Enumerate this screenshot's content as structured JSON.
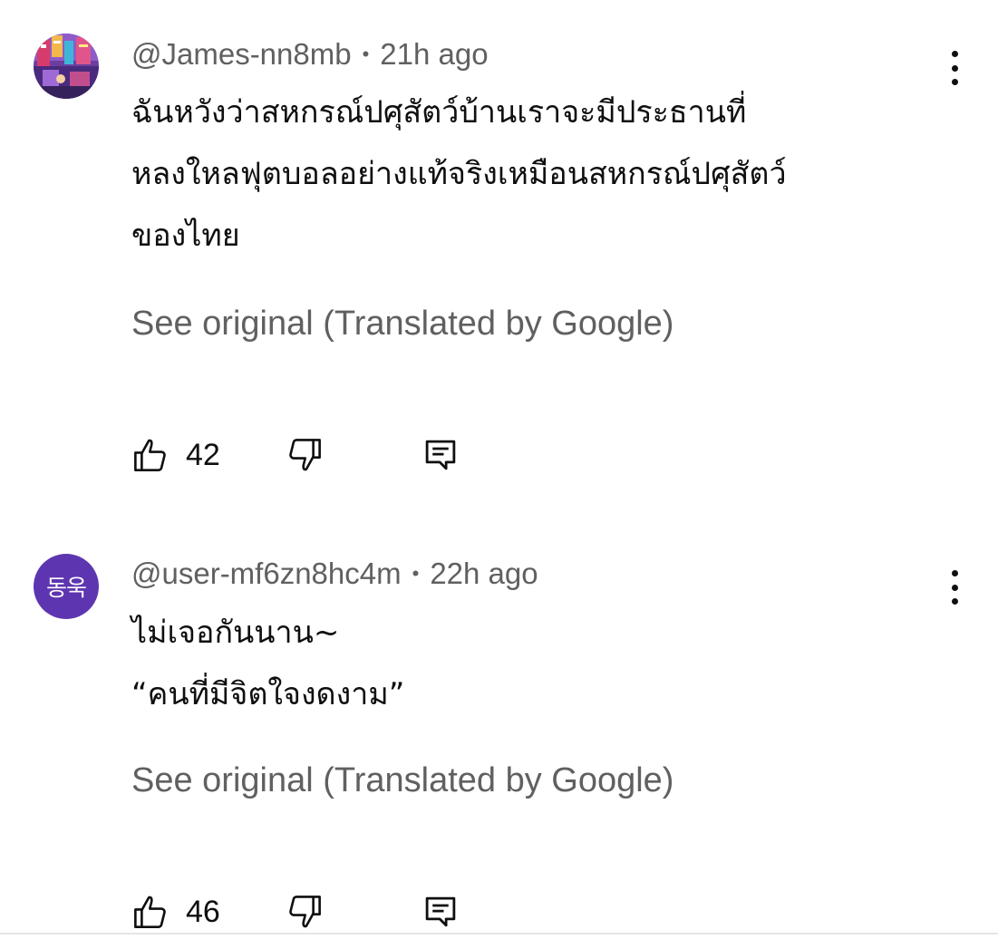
{
  "comments": [
    {
      "author": "@James-nn8mb",
      "time": "21h ago",
      "text": "ฉันหวังว่าสหกรณ์ปศุสัตว์บ้านเราจะมีประธานที่\nหลงใหลฟุตบอลอย่างแท้จริงเหมือนสหกรณ์ปศุสัตว์\nของไทย",
      "see_original": "See original (Translated by Google)",
      "likes": "42",
      "avatar_type": "image",
      "avatar_initials": ""
    },
    {
      "author": "@user-mf6zn8hc4m",
      "time": "22h ago",
      "text": "ไม่เจอกันนาน~\n“คนที่มีจิตใจงดงาม”",
      "see_original": "See original (Translated by Google)",
      "likes": "46",
      "avatar_type": "initials",
      "avatar_initials": "동욱"
    }
  ],
  "meta_separator": "•",
  "icons": {
    "like": "thumb-up-icon",
    "dislike": "thumb-down-icon",
    "reply": "reply-comment-icon",
    "more": "more-vertical-icon"
  },
  "colors": {
    "primary_text": "#0f0f0f",
    "secondary_text": "#606060",
    "avatar_purple": "#5e35b1",
    "divider": "#e5e5e5"
  }
}
